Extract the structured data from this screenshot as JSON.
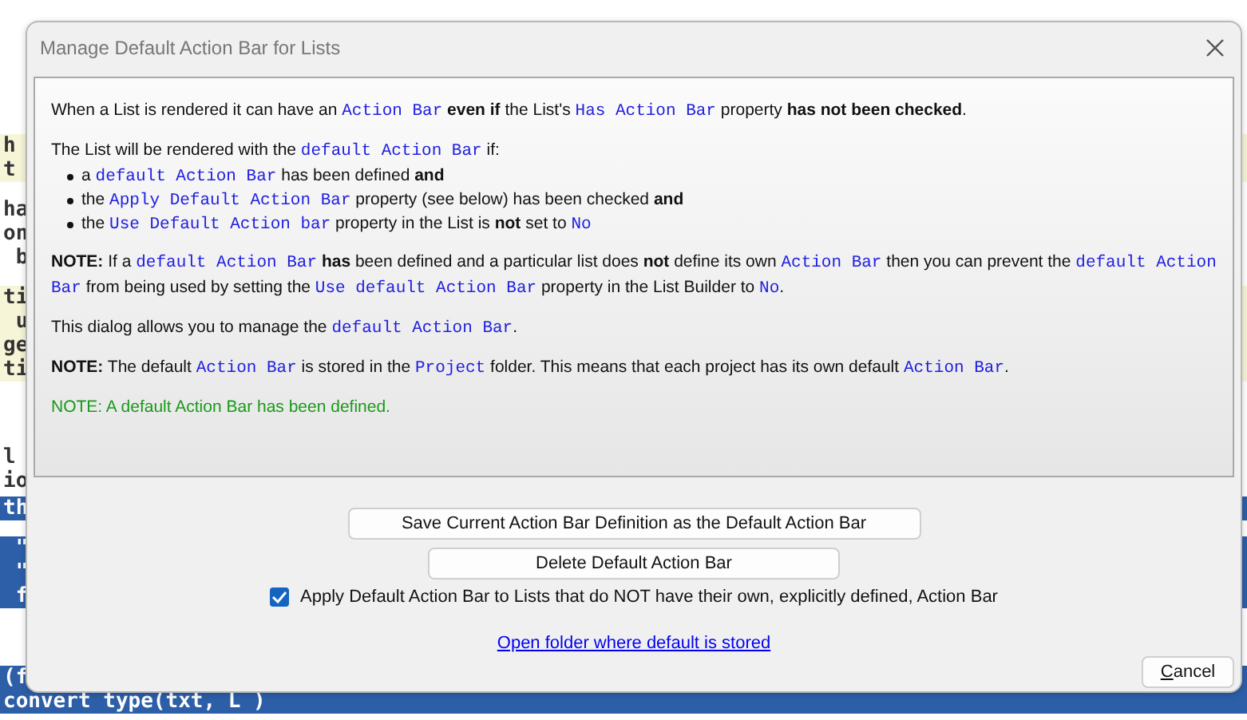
{
  "editor": {
    "blocks": [
      {
        "highlighted": true,
        "selected": false,
        "lines": [
          "h",
          "t"
        ]
      },
      {
        "highlighted": false,
        "selected": false,
        "lines": [
          "ha",
          "on",
          " b"
        ]
      },
      {
        "highlighted": true,
        "selected": false,
        "lines": [
          "ti",
          " u",
          "ge",
          "ti"
        ]
      },
      {
        "highlighted": false,
        "selected": false,
        "lines": [
          "l",
          "io"
        ]
      },
      {
        "highlighted": false,
        "selected": true,
        "lines": [
          "th"
        ]
      },
      {
        "highlighted": false,
        "selected": true,
        "lines": [
          " \"",
          " \"",
          " f"
        ]
      },
      {
        "highlighted": false,
        "selected": true,
        "lines": [
          "(f",
          "convert type(txt, L )"
        ]
      }
    ]
  },
  "dialog": {
    "title": "Manage Default Action Bar for Lists",
    "info": [
      {
        "kind": "paragraph",
        "segments": [
          {
            "kind": "text",
            "text": "When a List is rendered it can have an "
          },
          {
            "kind": "code",
            "text": "Action Bar"
          },
          {
            "kind": "bold",
            "text": " even if"
          },
          {
            "kind": "text",
            "text": " the List's "
          },
          {
            "kind": "code",
            "text": "Has Action Bar"
          },
          {
            "kind": "text",
            "text": " property "
          },
          {
            "kind": "bold",
            "text": "has not been checked"
          },
          {
            "kind": "text",
            "text": "."
          }
        ]
      },
      {
        "kind": "paragraph",
        "segments": [
          {
            "kind": "text",
            "text": "The List will be rendered with the "
          },
          {
            "kind": "code",
            "text": "default Action Bar"
          },
          {
            "kind": "text",
            "text": " if:"
          }
        ],
        "bullets": [
          [
            {
              "kind": "text",
              "text": "a "
            },
            {
              "kind": "code",
              "text": "default Action Bar"
            },
            {
              "kind": "text",
              "text": " has been defined "
            },
            {
              "kind": "bold",
              "text": "and"
            }
          ],
          [
            {
              "kind": "text",
              "text": "the "
            },
            {
              "kind": "code",
              "text": "Apply Default Action Bar"
            },
            {
              "kind": "text",
              "text": " property (see below) has been checked "
            },
            {
              "kind": "bold",
              "text": "and"
            }
          ],
          [
            {
              "kind": "text",
              "text": "the "
            },
            {
              "kind": "code",
              "text": "Use Default Action bar"
            },
            {
              "kind": "text",
              "text": " property in the List is "
            },
            {
              "kind": "bold",
              "text": "not"
            },
            {
              "kind": "text",
              "text": " set to "
            },
            {
              "kind": "code",
              "text": "No"
            }
          ]
        ]
      },
      {
        "kind": "paragraph",
        "segments": [
          {
            "kind": "bold",
            "text": "NOTE:"
          },
          {
            "kind": "text",
            "text": " If a "
          },
          {
            "kind": "code",
            "text": "default Action Bar"
          },
          {
            "kind": "bold",
            "text": " has"
          },
          {
            "kind": "text",
            "text": " been defined and a particular list does "
          },
          {
            "kind": "bold",
            "text": "not"
          },
          {
            "kind": "text",
            "text": " define its own "
          },
          {
            "kind": "code",
            "text": "Action Bar"
          },
          {
            "kind": "text",
            "text": " then you can prevent the "
          },
          {
            "kind": "code",
            "text": "default Action Bar"
          },
          {
            "kind": "text",
            "text": " from being used by setting the "
          },
          {
            "kind": "code",
            "text": "Use default Action Bar"
          },
          {
            "kind": "text",
            "text": " property in the List Builder to "
          },
          {
            "kind": "code",
            "text": "No"
          },
          {
            "kind": "text",
            "text": "."
          }
        ]
      },
      {
        "kind": "paragraph",
        "segments": [
          {
            "kind": "text",
            "text": "This dialog allows you to manage the "
          },
          {
            "kind": "code",
            "text": "default Action Bar"
          },
          {
            "kind": "text",
            "text": "."
          }
        ]
      },
      {
        "kind": "paragraph",
        "segments": [
          {
            "kind": "bold",
            "text": "NOTE:"
          },
          {
            "kind": "text",
            "text": " The default "
          },
          {
            "kind": "code",
            "text": "Action Bar"
          },
          {
            "kind": "text",
            "text": " is stored in the "
          },
          {
            "kind": "code",
            "text": "Project"
          },
          {
            "kind": "text",
            "text": " folder. This means that each project has its own default "
          },
          {
            "kind": "code",
            "text": "Action Bar"
          },
          {
            "kind": "text",
            "text": "."
          }
        ]
      },
      {
        "kind": "status",
        "segments": [
          {
            "kind": "text",
            "text": "NOTE: A default Action Bar has been defined."
          }
        ]
      }
    ],
    "save_button": "Save Current Action Bar Definition as the Default Action Bar",
    "delete_button": "Delete Default Action Bar",
    "apply_checkbox": {
      "label": "Apply Default Action Bar to Lists that do NOT have their own, explicitly defined, Action Bar",
      "checked": true
    },
    "folder_link": "Open folder where default is stored",
    "cancel_button": {
      "mnemonic": "C",
      "rest": "ancel"
    }
  }
}
